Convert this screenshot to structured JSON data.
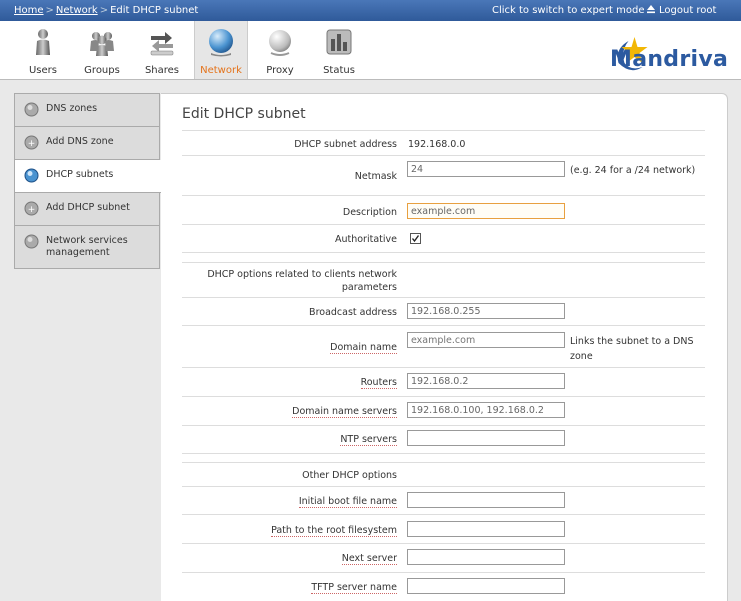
{
  "breadcrumb": {
    "home": "Home",
    "network": "Network",
    "current": "Edit DHCP subnet"
  },
  "topbar": {
    "expert": "Click to switch to expert mode",
    "logout": "Logout root"
  },
  "toolbar": {
    "items": [
      {
        "label": "Users",
        "icon": "users-icon"
      },
      {
        "label": "Groups",
        "icon": "groups-icon"
      },
      {
        "label": "Shares",
        "icon": "shares-icon"
      },
      {
        "label": "Network",
        "icon": "network-icon",
        "active": true
      },
      {
        "label": "Proxy",
        "icon": "proxy-icon"
      },
      {
        "label": "Status",
        "icon": "status-icon"
      }
    ],
    "logo": "Mandriva",
    "accent": "#e4731b"
  },
  "sidebar": {
    "items": [
      {
        "label": "DNS zones"
      },
      {
        "label": "Add DNS zone"
      },
      {
        "label": "DHCP subnets",
        "active": true
      },
      {
        "label": "Add DHCP subnet"
      },
      {
        "label": "Network services management"
      }
    ]
  },
  "form": {
    "title": "Edit DHCP subnet",
    "subnet_address_label": "DHCP subnet address",
    "subnet_address_value": "192.168.0.0",
    "netmask_label": "Netmask",
    "netmask_value": "24",
    "netmask_hint": "(e.g. 24 for a /24 network)",
    "description_label": "Description",
    "description_value": "example.com",
    "authoritative_label": "Authoritative",
    "authoritative_checked": true,
    "client_options_header": "DHCP options related to clients network parameters",
    "broadcast_label": "Broadcast address",
    "broadcast_value": "192.168.0.255",
    "domain_name_label": "Domain name",
    "domain_name_placeholder": "example.com",
    "domain_name_hint": "Links the subnet to a DNS zone",
    "routers_label": "Routers",
    "routers_value": "192.168.0.2",
    "dns_servers_label": "Domain name servers",
    "dns_servers_value": "192.168.0.100, 192.168.0.2",
    "ntp_label": "NTP servers",
    "ntp_value": "",
    "other_options_header": "Other DHCP options",
    "boot_file_label": "Initial boot file name",
    "boot_file_value": "",
    "root_path_label": "Path to the root filesystem",
    "root_path_value": "",
    "next_server_label": "Next server",
    "next_server_value": "",
    "tftp_label": "TFTP server name",
    "tftp_value": ""
  }
}
